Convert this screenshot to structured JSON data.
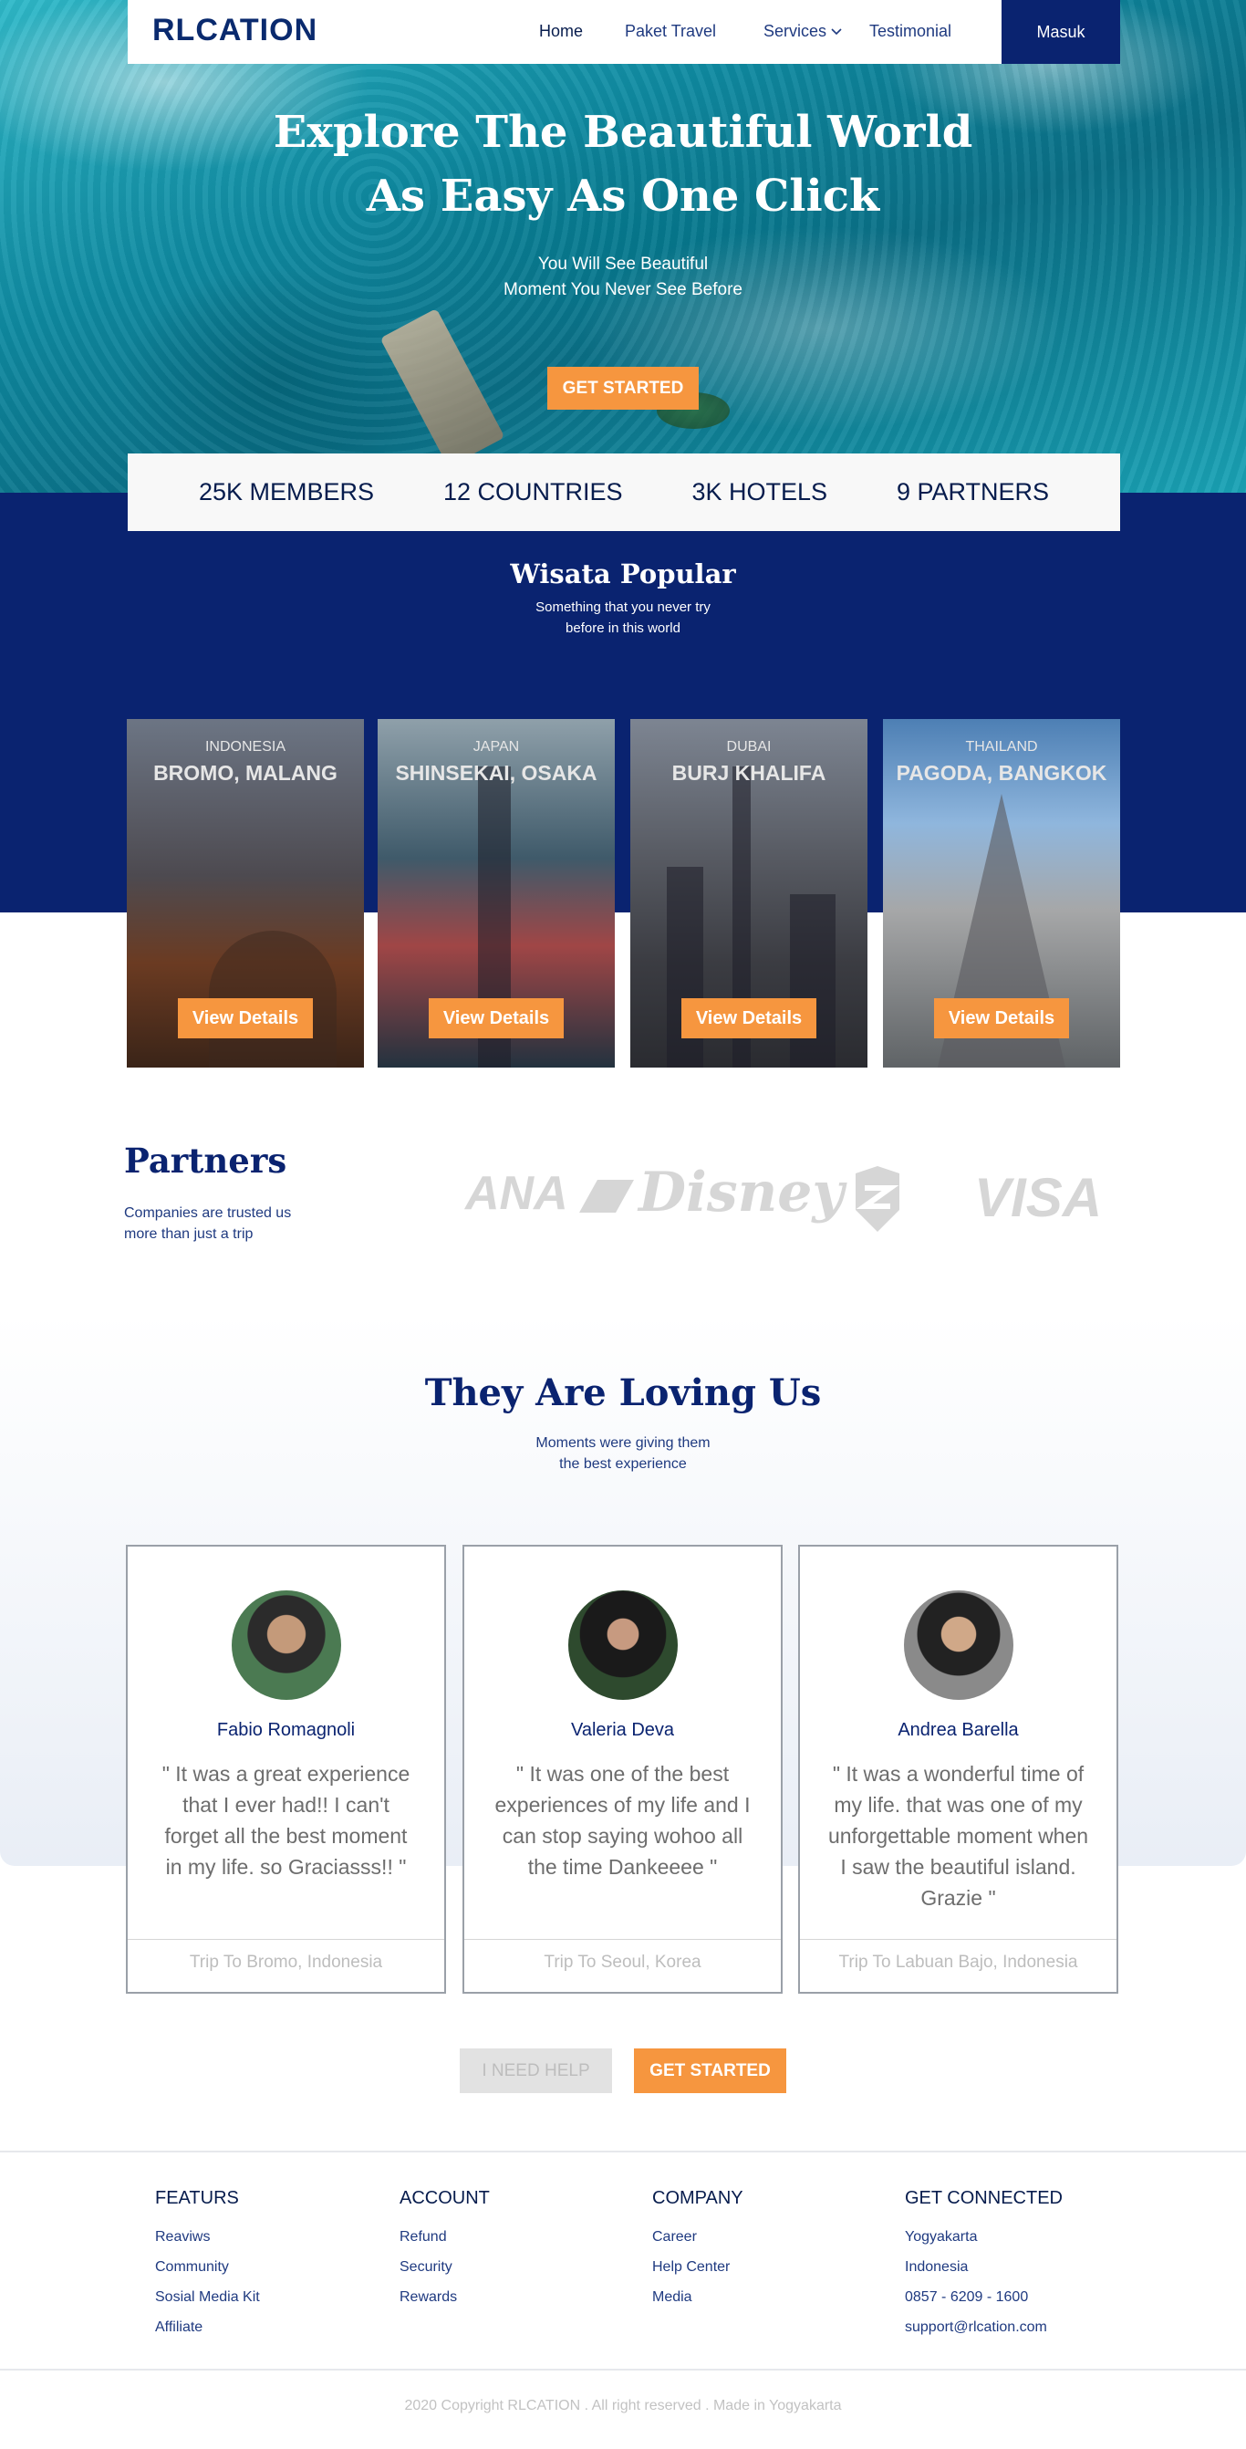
{
  "nav": {
    "logo": "RLCATION",
    "links": [
      "Home",
      "Paket Travel",
      "Services",
      "Testimonial"
    ],
    "login": "Masuk"
  },
  "hero": {
    "title_line1": "Explore The Beautiful World",
    "title_line2": "As Easy As One Click",
    "sub_line1": "You Will See Beautiful",
    "sub_line2": "Moment You Never See Before",
    "cta": "GET STARTED"
  },
  "stats": [
    "25K MEMBERS",
    "12 COUNTRIES",
    "3K HOTELS",
    "9 PARTNERS"
  ],
  "popular": {
    "title": "Wisata Popular",
    "sub_line1": "Something that you never try",
    "sub_line2": "before in this world",
    "cards": [
      {
        "country": "INDONESIA",
        "place": "BROMO, MALANG",
        "button": "View Details"
      },
      {
        "country": "JAPAN",
        "place": "SHINSEKAI, OSAKA",
        "button": "View Details"
      },
      {
        "country": "DUBAI",
        "place": "BURJ KHALIFA",
        "button": "View Details"
      },
      {
        "country": "THAILAND",
        "place": "PAGODA, BANGKOK",
        "button": "View Details"
      }
    ]
  },
  "partners": {
    "title": "Partners",
    "sub_line1": "Companies are trusted us",
    "sub_line2": "more than just a trip",
    "logos": [
      "ANA",
      "Disney",
      "VISA"
    ]
  },
  "testimonials": {
    "title": "They Are Loving Us",
    "sub_line1": "Moments were giving them",
    "sub_line2": "the best experience",
    "items": [
      {
        "name": "Fabio Romagnoli",
        "quote": "\" It was a great experience that I ever had!! I can't forget all the best moment in my life. so Graciasss!! \"",
        "trip": "Trip To Bromo, Indonesia"
      },
      {
        "name": "Valeria Deva",
        "quote": "\" It was one of the best experiences of my life and I can stop saying wohoo all the time Dankeeee \"",
        "trip": "Trip To Seoul, Korea"
      },
      {
        "name": "Andrea Barella",
        "quote": "\" It was a wonderful time of my life. that was one of my unforgettable moment when I saw the beautiful island. Grazie \"",
        "trip": "Trip To Labuan Bajo, Indonesia"
      }
    ]
  },
  "cta": {
    "help": "I NEED HELP",
    "start": "GET STARTED"
  },
  "footer": {
    "columns": [
      {
        "title": "FEATURS",
        "items": [
          "Reaviws",
          "Community",
          "Sosial Media Kit",
          "Affiliate"
        ]
      },
      {
        "title": "ACCOUNT",
        "items": [
          "Refund",
          "Security",
          "Rewards"
        ]
      },
      {
        "title": "COMPANY",
        "items": [
          "Career",
          "Help Center",
          "Media"
        ]
      },
      {
        "title": "GET CONNECTED",
        "items": [
          "Yogyakarta",
          "Indonesia",
          "0857 - 6209 - 1600",
          "support@rlcation.com"
        ]
      }
    ],
    "copyright": "2020 Copyright RLCATION . All right reserved . Made in Yogyakarta"
  },
  "colors": {
    "navy": "#0a2370",
    "orange": "#f6963f",
    "text": "#071c4d"
  }
}
